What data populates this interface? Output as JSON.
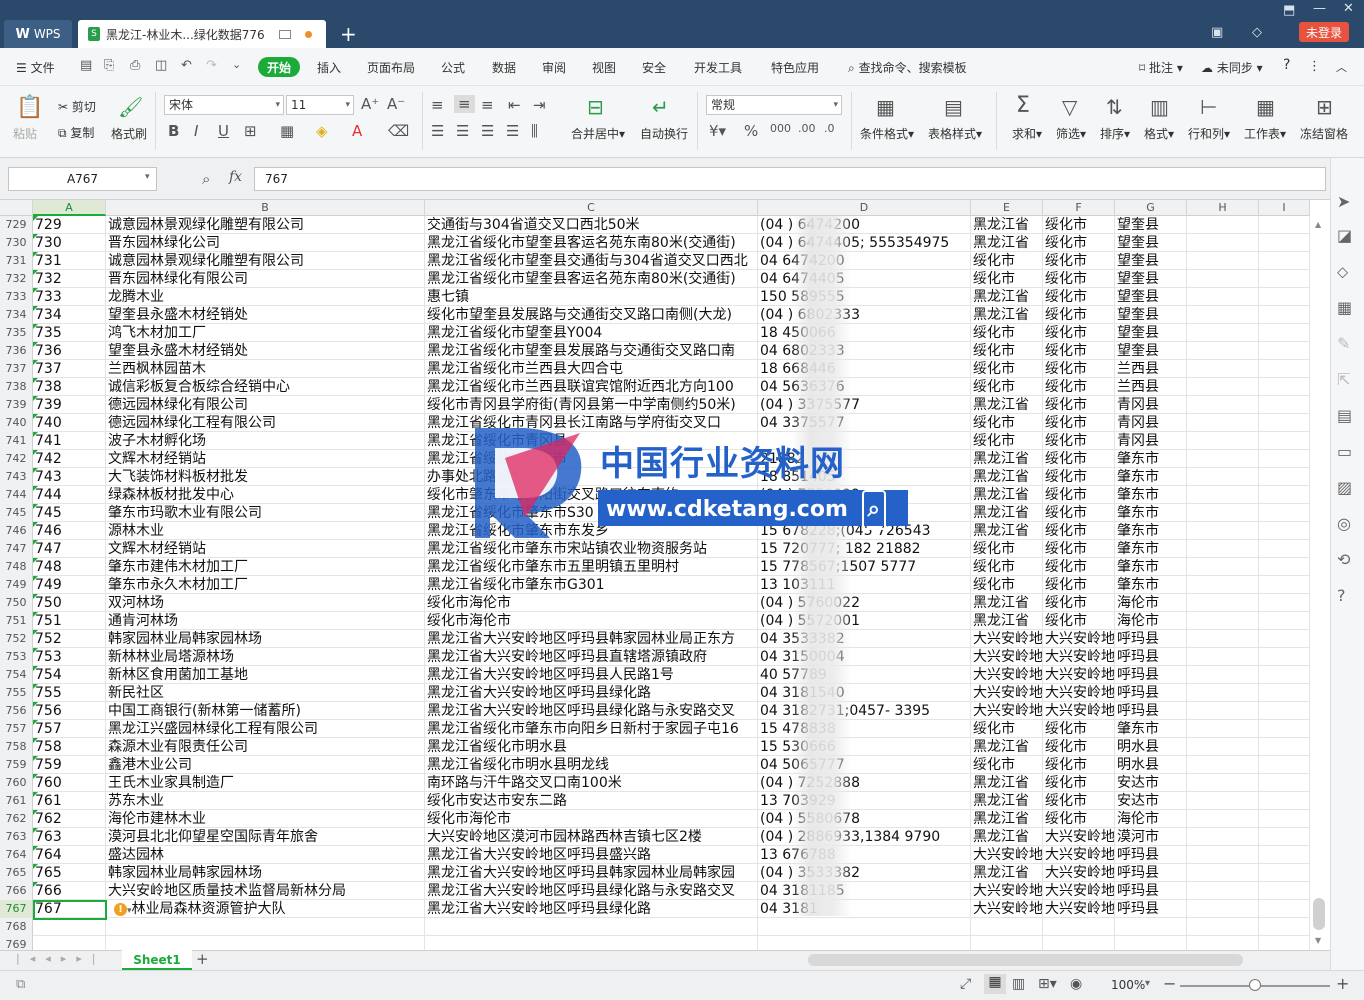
{
  "titlebar": {
    "app_tab": "WPS",
    "doc_tab": "黑龙江-林业木...绿化数据776",
    "login_button": "未登录"
  },
  "menu": {
    "file": "文件",
    "items": [
      "开始",
      "插入",
      "页面布局",
      "公式",
      "数据",
      "审阅",
      "视图",
      "安全",
      "开发工具",
      "特色应用"
    ],
    "search": "查找命令、搜索模板",
    "annotate": "批注",
    "sync": "未同步"
  },
  "ribbon": {
    "paste": "粘贴",
    "cut": "剪切",
    "copy": "复制",
    "format_painter": "格式刷",
    "font_name": "宋体",
    "font_size": "11",
    "merge_center": "合并居中",
    "wrap_text": "自动换行",
    "number_format": "常规",
    "cond_format": "条件格式",
    "table_style": "表格样式",
    "sum": "求和",
    "filter": "筛选",
    "sort": "排序",
    "format": "格式",
    "row_col": "行和列",
    "worksheet": "工作表",
    "freeze": "冻结窗格"
  },
  "formula_bar": {
    "name_box": "A767",
    "fx": "fx",
    "value": "767"
  },
  "columns": [
    "A",
    "B",
    "C",
    "D",
    "E",
    "F",
    "G",
    "H",
    "I"
  ],
  "rows": [
    [
      "729",
      "729",
      "诚意园林景观绿化雕塑有限公司",
      "交通街与304省道交叉口西北50米",
      "(04  ) 6474200",
      "黑龙江省",
      "绥化市",
      "望奎县"
    ],
    [
      "730",
      "730",
      "晋东园林绿化公司",
      "黑龙江省绥化市望奎县客运名苑东南80米(交通街)",
      "(04  ) 6474405;    555354975",
      "黑龙江省",
      "绥化市",
      "望奎县"
    ],
    [
      "731",
      "731",
      "诚意园林景观绿化雕塑有限公司",
      "黑龙江省绥化市望奎县交通街与304省道交叉口西北",
      "04    6474200",
      "绥化市",
      "绥化市",
      "望奎县"
    ],
    [
      "732",
      "732",
      "晋东园林绿化有限公司",
      "黑龙江省绥化市望奎县客运名苑东南80米(交通街)",
      "04    6474405",
      "绥化市",
      "绥化市",
      "望奎县"
    ],
    [
      "733",
      "733",
      "龙腾木业",
      "惠七镇",
      "150    589555",
      "黑龙江省",
      "绥化市",
      "望奎县"
    ],
    [
      "734",
      "734",
      "望奎县永盛木材经销处",
      "绥化市望奎县发展路与交通街交叉路口南侧(大龙)",
      "(04  ) 6802333",
      "黑龙江省",
      "绥化市",
      "望奎县"
    ],
    [
      "735",
      "735",
      "鸿飞木材加工厂",
      "黑龙江省绥化市望奎县Y004",
      "18    450066",
      "绥化市",
      "绥化市",
      "望奎县"
    ],
    [
      "736",
      "736",
      "望奎县永盛木材经销处",
      "黑龙江省绥化市望奎县发展路与交通街交叉路口南",
      "04    6802333",
      "绥化市",
      "绥化市",
      "望奎县"
    ],
    [
      "737",
      "737",
      "兰西枫林园苗木",
      "黑龙江省绥化市兰西县大四合屯",
      "18    668446",
      "绥化市",
      "绥化市",
      "兰西县"
    ],
    [
      "738",
      "738",
      "诚信彩板复合板综合经销中心",
      "黑龙江省绥化市兰西县联谊宾馆附近西北方向100",
      "04    5636376",
      "绥化市",
      "绥化市",
      "兰西县"
    ],
    [
      "739",
      "739",
      "德远园林绿化有限公司",
      "绥化市青冈县学府街(青冈县第一中学南侧约50米)",
      "(04  ) 3375577",
      "黑龙江省",
      "绥化市",
      "青冈县"
    ],
    [
      "740",
      "740",
      "德远园林绿化工程有限公司",
      "黑龙江省绥化市青冈县长江南路与学府街交叉口",
      "04    3375577",
      "绥化市",
      "绥化市",
      "青冈县"
    ],
    [
      "741",
      "741",
      "波子木材孵化场",
      "黑龙江省绥化市青冈县",
      "",
      "绥化市",
      "绥化市",
      "青冈县"
    ],
    [
      "742",
      "742",
      "文辉木材经销站",
      "黑龙江省绥化市肇东市",
      "          21882",
      "黑龙江省",
      "绥化市",
      "肇东市"
    ],
    [
      "743",
      "743",
      "大飞装饰材料板材批发",
      "办事处北路盛世区",
      "18    851405",
      "黑龙江省",
      "绥化市",
      "肇东市"
    ],
    [
      "744",
      "744",
      "绿森林板材批发中心",
      "绥化市肇东市与向阳街交叉路口往东南约",
      "(04  ) 7750999",
      "黑龙江省",
      "绥化市",
      "肇东市"
    ],
    [
      "745",
      "745",
      "肇东市玛歌木业有限公司",
      "黑龙江省绥化市肇东市S30",
      "",
      "黑龙江省",
      "绥化市",
      "肇东市"
    ],
    [
      "746",
      "746",
      "源林木业",
      "黑龙江省绥化市肇东市东发乡",
      "15    678228;(045    726543",
      "黑龙江省",
      "绥化市",
      "肇东市"
    ],
    [
      "747",
      "747",
      "文辉木材经销站",
      "黑龙江省绥化市肇东市宋站镇农业物资服务站",
      "15    720777; 182    21882",
      "绥化市",
      "绥化市",
      "肇东市"
    ],
    [
      "748",
      "748",
      "肇东市建伟木材加工厂",
      "黑龙江省绥化市肇东市五里明镇五里明村",
      "15    778567;1507    5777",
      "绥化市",
      "绥化市",
      "肇东市"
    ],
    [
      "749",
      "749",
      "肇东市永久木材加工厂",
      "黑龙江省绥化市肇东市G301",
      "13    103111",
      "绥化市",
      "绥化市",
      "肇东市"
    ],
    [
      "750",
      "750",
      "双河林场",
      "绥化市海伦市",
      "(04  ) 5760022",
      "黑龙江省",
      "绥化市",
      "海伦市"
    ],
    [
      "751",
      "751",
      "通肯河林场",
      "绥化市海伦市",
      "(04  ) 5572001",
      "黑龙江省",
      "绥化市",
      "海伦市"
    ],
    [
      "752",
      "752",
      "韩家园林业局韩家园林场",
      "黑龙江省大兴安岭地区呼玛县韩家园林业局正东方",
      "04    3533382",
      "大兴安岭地",
      "大兴安岭地",
      "呼玛县"
    ],
    [
      "753",
      "753",
      "新林林业局塔源林场",
      "黑龙江省大兴安岭地区呼玛县直辖塔源镇政府",
      "04    3150004",
      "大兴安岭地",
      "大兴安岭地",
      "呼玛县"
    ],
    [
      "754",
      "754",
      "新林区食用菌加工基地",
      "黑龙江省大兴安岭地区呼玛县人民路1号",
      "40    57789",
      "大兴安岭地",
      "大兴安岭地",
      "呼玛县"
    ],
    [
      "755",
      "755",
      "新民社区",
      "黑龙江省大兴安岭地区呼玛县绿化路",
      "04    3181540",
      "大兴安岭地",
      "大兴安岭地",
      "呼玛县"
    ],
    [
      "756",
      "756",
      "中国工商银行(新林第一储蓄所)",
      "黑龙江省大兴安岭地区呼玛县绿化路与永安路交叉",
      "04    3182731;0457-    3395",
      "大兴安岭地",
      "大兴安岭地",
      "呼玛县"
    ],
    [
      "757",
      "757",
      "黑龙江兴盛园林绿化工程有限公司",
      "黑龙江省绥化市肇东市向阳乡日新村于家园子屯16",
      "15    478838",
      "绥化市",
      "绥化市",
      "肇东市"
    ],
    [
      "758",
      "758",
      "森源木业有限责任公司",
      "黑龙江省绥化市明水县",
      "15    530666",
      "黑龙江省",
      "绥化市",
      "明水县"
    ],
    [
      "759",
      "759",
      "鑫港木业公司",
      "黑龙江省绥化市明水县明龙线",
      "04    5065777",
      "绥化市",
      "绥化市",
      "明水县"
    ],
    [
      "760",
      "760",
      "王氏木业家具制造厂",
      "南环路与汗牛路交叉口南100米",
      "(04  ) 7252888",
      "黑龙江省",
      "绥化市",
      "安达市"
    ],
    [
      "761",
      "761",
      "苏东木业",
      "绥化市安达市安东二路",
      "13    703929",
      "黑龙江省",
      "绥化市",
      "安达市"
    ],
    [
      "762",
      "762",
      "海伦市建林木业",
      "绥化市海伦市",
      "(04  ) 5580678",
      "黑龙江省",
      "绥化市",
      "海伦市"
    ],
    [
      "763",
      "763",
      "漠河县北北仰望星空国际青年旅舍",
      "大兴安岭地区漠河市园林路西林吉镇七区2楼",
      "(04  ) 2886933,1384    9790",
      "黑龙江省",
      "大兴安岭地",
      "漠河市"
    ],
    [
      "764",
      "764",
      "盛达园林",
      "黑龙江省大兴安岭地区呼玛县盛兴路",
      "13    676788",
      "大兴安岭地",
      "大兴安岭地",
      "呼玛县"
    ],
    [
      "765",
      "765",
      "韩家园林业局韩家园林场",
      "黑龙江省大兴安岭地区呼玛县韩家园林业局韩家园",
      "(04  ) 3533382",
      "黑龙江省",
      "大兴安岭地",
      "呼玛县"
    ],
    [
      "766",
      "766",
      "大兴安岭地区质量技术监督局新林分局",
      "黑龙江省大兴安岭地区呼玛县绿化路与永安路交叉",
      "04    3181185",
      "大兴安岭地",
      "大兴安岭地",
      "呼玛县"
    ],
    [
      "767",
      "767",
      "林业局森林资源管护大队",
      "黑龙江省大兴安岭地区呼玛县绿化路",
      "04    3181",
      "大兴安岭地",
      "大兴安岭地",
      "呼玛县"
    ],
    [
      "768",
      "",
      "",
      "",
      "",
      "",
      "",
      ""
    ],
    [
      "769",
      "",
      "",
      "",
      "",
      "",
      "",
      ""
    ]
  ],
  "watermark": {
    "title": "中国行业资料网",
    "url": "www.cdketang.com"
  },
  "sheet_tab": "Sheet1",
  "status": {
    "zoom": "100%"
  }
}
